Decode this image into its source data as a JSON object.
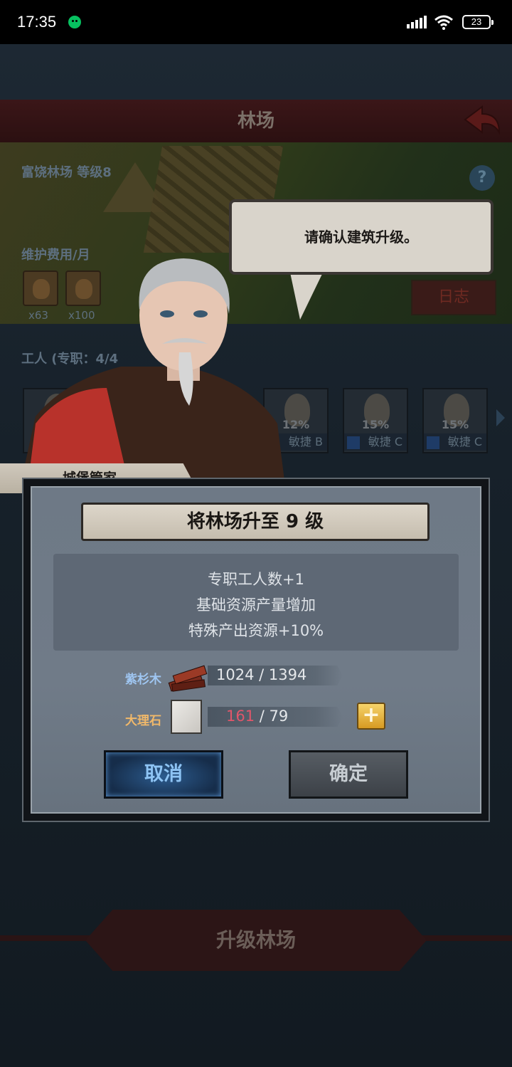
{
  "status_bar": {
    "time": "17:35",
    "battery": "23"
  },
  "background": {
    "title": "林场",
    "building_name_level": "富饶林场 等级8",
    "maintenance_label": "维护费用/月",
    "costs": [
      "x63",
      "x100"
    ],
    "log_button": "日志",
    "workers_label": "工人 (专职：4/4",
    "workers": [
      {
        "percent": "12%",
        "trait": "敏捷 B"
      },
      {
        "percent": "15%",
        "trait": "敏捷 C"
      },
      {
        "percent": "15%",
        "trait": "敏捷 C"
      }
    ],
    "upgrade_button": "升级林场"
  },
  "speech": {
    "text": "请确认建筑升级。"
  },
  "character": {
    "name": "城堡管家"
  },
  "dialog": {
    "title": "将林场升至 9 级",
    "benefits": [
      "专职工人数+1",
      "基础资源产量增加",
      "特殊产出资源+10%"
    ],
    "resources": [
      {
        "name": "紫杉木",
        "have": "1024",
        "need": "1394",
        "name_color": "#9fc6f2"
      },
      {
        "name": "大理石",
        "have": "161",
        "need": "79",
        "name_color": "#f0b86a"
      }
    ],
    "cancel_button": "取消",
    "confirm_button": "确定",
    "plus_symbol": "+"
  },
  "colors": {
    "accent_blue": "#8ec4f4",
    "warning_red": "#e0566a"
  }
}
